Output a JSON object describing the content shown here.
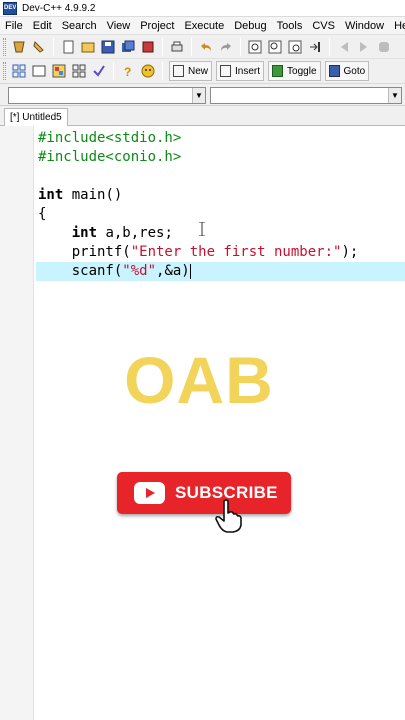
{
  "window": {
    "title": "Dev-C++ 4.9.9.2",
    "app_icon": "dev-cpp-icon"
  },
  "menu": [
    "File",
    "Edit",
    "Search",
    "View",
    "Project",
    "Execute",
    "Debug",
    "Tools",
    "CVS",
    "Window",
    "Help"
  ],
  "toolbar2": {
    "new_label": "New",
    "insert_label": "Insert",
    "toggle_label": "Toggle",
    "goto_label": "Goto"
  },
  "combos": {
    "class_value": "",
    "member_value": ""
  },
  "tabs": [
    {
      "label": "[*] Untitled5",
      "active": true
    }
  ],
  "code_lines": [
    "#include<stdio.h>",
    "#include<conio.h>",
    "",
    "int main()",
    "{",
    "    int a,b,res;",
    "    printf(\"Enter the first number:\");",
    "    scanf(\"%d\",&a)"
  ],
  "code_tokens": {
    "l0": "#include<stdio.h>",
    "l1": "#include<conio.h>",
    "l3_kw": "int",
    "l3_rest": " main()",
    "l4": "{",
    "l5_indent": "    ",
    "l5_kw": "int",
    "l5_rest": " a,b,res;",
    "l6_pre": "    printf(",
    "l6_str": "\"Enter the first number:\"",
    "l6_post": ");",
    "l7_pre": "    scanf(",
    "l7_str": "\"%d\"",
    "l7_post": ",&a)"
  },
  "overlay": {
    "watermark": "OAB",
    "subscribe_label": "SUBSCRIBE"
  },
  "colors": {
    "active_line": "#c9f3ff",
    "preprocessor": "#0e8a16",
    "string": "#c8102e",
    "watermark": "#eecd3c",
    "subscribe_bg": "#e62429"
  }
}
